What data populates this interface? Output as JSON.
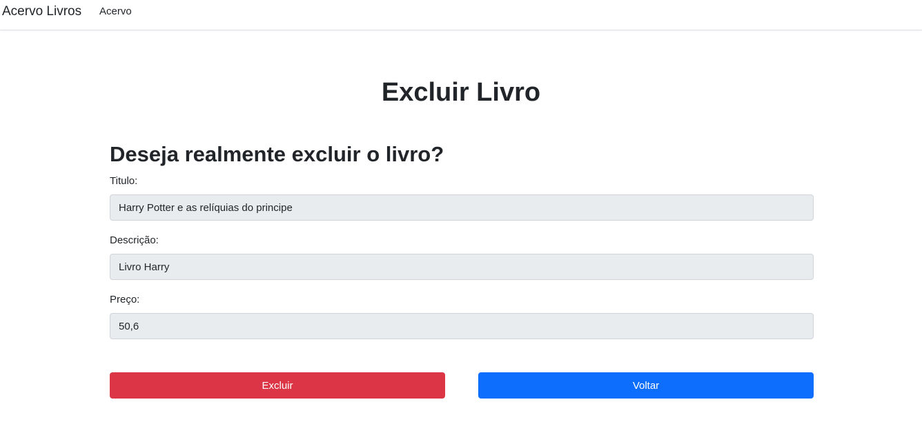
{
  "navbar": {
    "brand": "Acervo Livros",
    "links": [
      {
        "label": "Acervo"
      }
    ]
  },
  "main": {
    "title": "Excluir Livro",
    "question": "Deseja realmente excluir o livro?",
    "fields": [
      {
        "label": "Titulo:",
        "value": "Harry Potter e as relíquias do principe"
      },
      {
        "label": "Descrição:",
        "value": "Livro Harry"
      },
      {
        "label": "Preço:",
        "value": "50,6"
      }
    ],
    "buttons": {
      "delete_label": "Excluir",
      "back_label": "Voltar"
    }
  },
  "colors": {
    "danger": "#dc3545",
    "primary": "#0d6efd",
    "input_readonly_bg": "#e9ecef"
  }
}
